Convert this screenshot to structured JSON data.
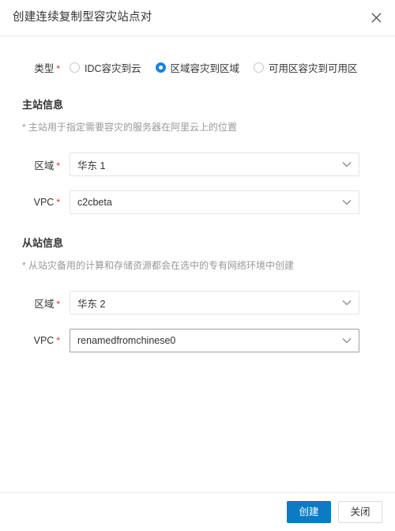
{
  "dialog": {
    "title": "创建连续复制型容灾站点对",
    "close_icon": "close-icon"
  },
  "form": {
    "type_field": {
      "label": "类型",
      "required_mark": "*",
      "options": [
        {
          "label": "IDC容灾到云",
          "selected": false
        },
        {
          "label": "区域容灾到区域",
          "selected": true
        },
        {
          "label": "可用区容灾到可用区",
          "selected": false
        }
      ]
    },
    "primary_section": {
      "title": "主站信息",
      "hint": "* 主站用于指定需要容灾的服务器在阿里云上的位置",
      "region": {
        "label": "区域",
        "required_mark": "*",
        "value": "华东 1",
        "arrow_icon": "chevron-down-icon"
      },
      "vpc": {
        "label": "VPC",
        "required_mark": "*",
        "value": "c2cbeta",
        "arrow_icon": "chevron-down-icon"
      }
    },
    "secondary_section": {
      "title": "从站信息",
      "hint": "* 从站灾备用的计算和存储资源都会在选中的专有网络环境中创建",
      "region": {
        "label": "区域",
        "required_mark": "*",
        "value": "华东 2",
        "arrow_icon": "chevron-down-icon"
      },
      "vpc": {
        "label": "VPC",
        "required_mark": "*",
        "value": "renamedfromchinese0",
        "arrow_icon": "chevron-down-icon"
      }
    }
  },
  "footer": {
    "primary_label": "创建",
    "close_label": "关闭"
  },
  "colors": {
    "accent": "#0d7ac4",
    "radio_selected": "#1684e0",
    "required": "#d93026",
    "hint_text": "#999999",
    "border": "#e3e4e6"
  }
}
